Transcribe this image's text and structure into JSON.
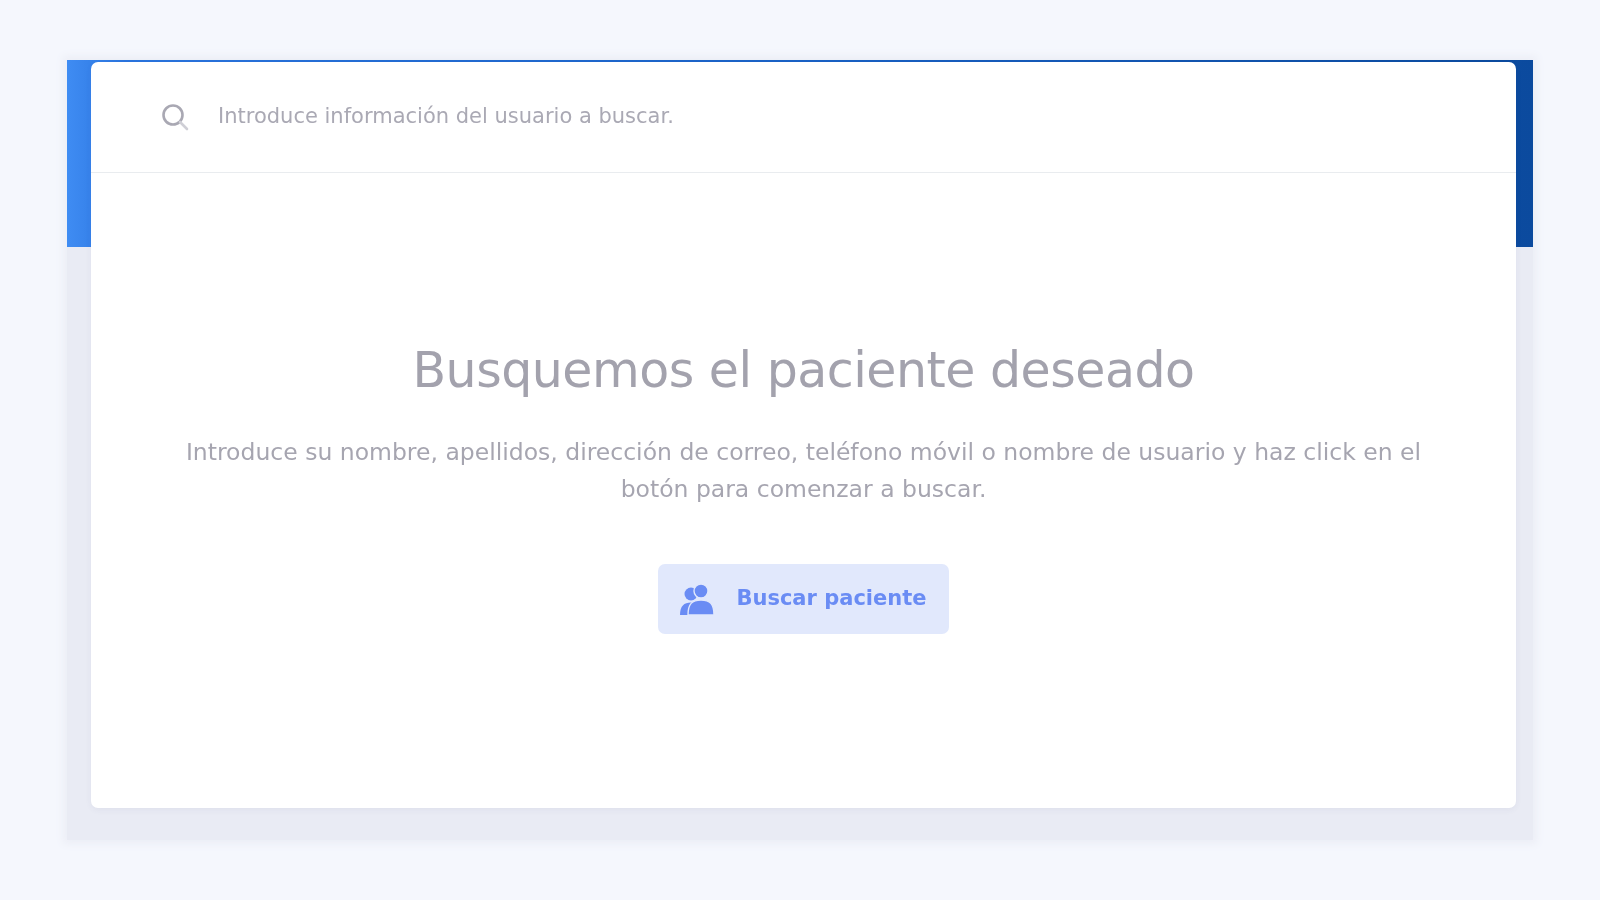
{
  "search": {
    "placeholder": "Introduce información del usuario a buscar."
  },
  "empty_state": {
    "title": "Busquemos el paciente deseado",
    "text": "Introduce su nombre, apellidos, dirección de correo, teléfono móvil o nombre de usuario y haz click en el botón para comenzar a buscar.",
    "button": {
      "label": "Buscar paciente"
    }
  }
}
